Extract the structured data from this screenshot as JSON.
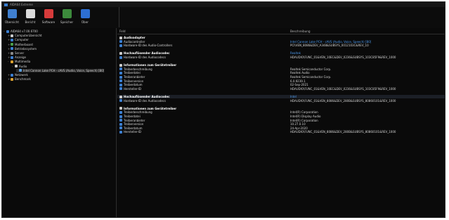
{
  "window": {
    "title": "AIDA64 Extreme"
  },
  "toolbar": [
    {
      "label": "Übersicht",
      "color": "#3f7fcf"
    },
    {
      "label": "Bericht",
      "color": "#dadada"
    },
    {
      "label": "Software",
      "color": "#d63b3b"
    },
    {
      "label": "Speicher",
      "color": "#3c8a3c"
    },
    {
      "label": "Über",
      "color": "#2d6fd2"
    }
  ],
  "tree": [
    {
      "label": "AIDA64 v7.00.6700",
      "indent": 0,
      "exp": "-",
      "color": "#3b7fd1"
    },
    {
      "label": "Computerübersicht",
      "indent": 1,
      "exp": "+",
      "color": "#c9c9c9"
    },
    {
      "label": "Computer",
      "indent": 1,
      "exp": "+",
      "color": "#3b7fd1"
    },
    {
      "label": "Motherboard",
      "indent": 1,
      "exp": "+",
      "color": "#4a9f4a"
    },
    {
      "label": "Betriebssystem",
      "indent": 1,
      "exp": "+",
      "color": "#3b7fd1"
    },
    {
      "label": "Server",
      "indent": 1,
      "exp": "+",
      "color": "#8a8a8a"
    },
    {
      "label": "Anzeige",
      "indent": 1,
      "exp": "+",
      "color": "#3b7fd1"
    },
    {
      "label": "Multimedia",
      "indent": 1,
      "exp": "-",
      "color": "#d9a030"
    },
    {
      "label": "Audio",
      "indent": 2,
      "exp": "-",
      "color": "#c9c9c9"
    },
    {
      "label": "Intel Cannon Lake PCH - cAVS (Audio, Voice, Speech) [B0]",
      "indent": 3,
      "exp": "",
      "color": "#5a9fe0",
      "selected": true
    },
    {
      "label": "Netzwerk",
      "indent": 1,
      "exp": "+",
      "color": "#3b7fd1"
    },
    {
      "label": "Benchmark",
      "indent": 1,
      "exp": "+",
      "color": "#d9a030"
    }
  ],
  "columns": {
    "field": "Feld",
    "value": "Beschreibung"
  },
  "rows": [
    {
      "f": "Audioadapter",
      "v": "",
      "group": true
    },
    {
      "f": "Audiocontroller",
      "v": "Intel Cannon Lake PCH - cAVS (Audio, Voice, Speech) [B0]",
      "blue": true
    },
    {
      "f": "Hardware-ID des Audio-Controllers",
      "v": "PCI\\VEN_8086&DEV_A348&SUBSYS_0012103C&REV_10"
    },
    {
      "f": "",
      "v": ""
    },
    {
      "f": "Hochauflösender Audiocodec",
      "v": "Realtek",
      "group": true,
      "blue": true
    },
    {
      "f": "Hardware-ID des Audiocodecs",
      "v": "HDAUDIO\\FUNC_01&VEN_10EC&DEV_0236&SUBSYS_103C85F9&REV_1000"
    },
    {
      "f": "",
      "v": ""
    },
    {
      "f": "Informationen zum Gerätetreiber",
      "v": "",
      "group": true
    },
    {
      "f": "Treiberbeschreibung",
      "v": "Realtek Semiconductor Corp."
    },
    {
      "f": "Treiberdatei",
      "v": "Realtek Audio"
    },
    {
      "f": "Treiberanbieter",
      "v": "Realtek Semiconductor Corp."
    },
    {
      "f": "Treiberversion",
      "v": "6.0.9239.1"
    },
    {
      "f": "Treiberdatum",
      "v": "02-Sep-2021"
    },
    {
      "f": "Hersteller-ID",
      "v": "HDAUDIO\\FUNC_01&VEN_10EC&DEV_0236&SUBSYS_103C85F9&REV_1000"
    },
    {
      "f": "",
      "v": ""
    },
    {
      "f": "Hochauflösender Audiocodec",
      "v": "Intel",
      "group": true,
      "blue": true,
      "hl": true
    },
    {
      "f": "Hardware-ID des Audiocodecs",
      "v": "HDAUDIO\\FUNC_01&VEN_8086&DEV_280B&SUBSYS_80860101&REV_1000"
    },
    {
      "f": "",
      "v": ""
    },
    {
      "f": "Informationen zum Gerätetreiber",
      "v": "",
      "group": true
    },
    {
      "f": "Treiberbeschreibung",
      "v": "Intel(R) Corporation"
    },
    {
      "f": "Treiberdatei",
      "v": "Intel(R) Display Audio"
    },
    {
      "f": "Treiberanbieter",
      "v": "Intel(R) Corporation"
    },
    {
      "f": "Treiberversion",
      "v": "10.27.0.10"
    },
    {
      "f": "Treiberdatum",
      "v": "24-Apr-2020"
    },
    {
      "f": "Hersteller-ID",
      "v": "HDAUDIO\\FUNC_01&VEN_8086&DEV_280B&SUBSYS_80860101&REV_1000"
    }
  ]
}
